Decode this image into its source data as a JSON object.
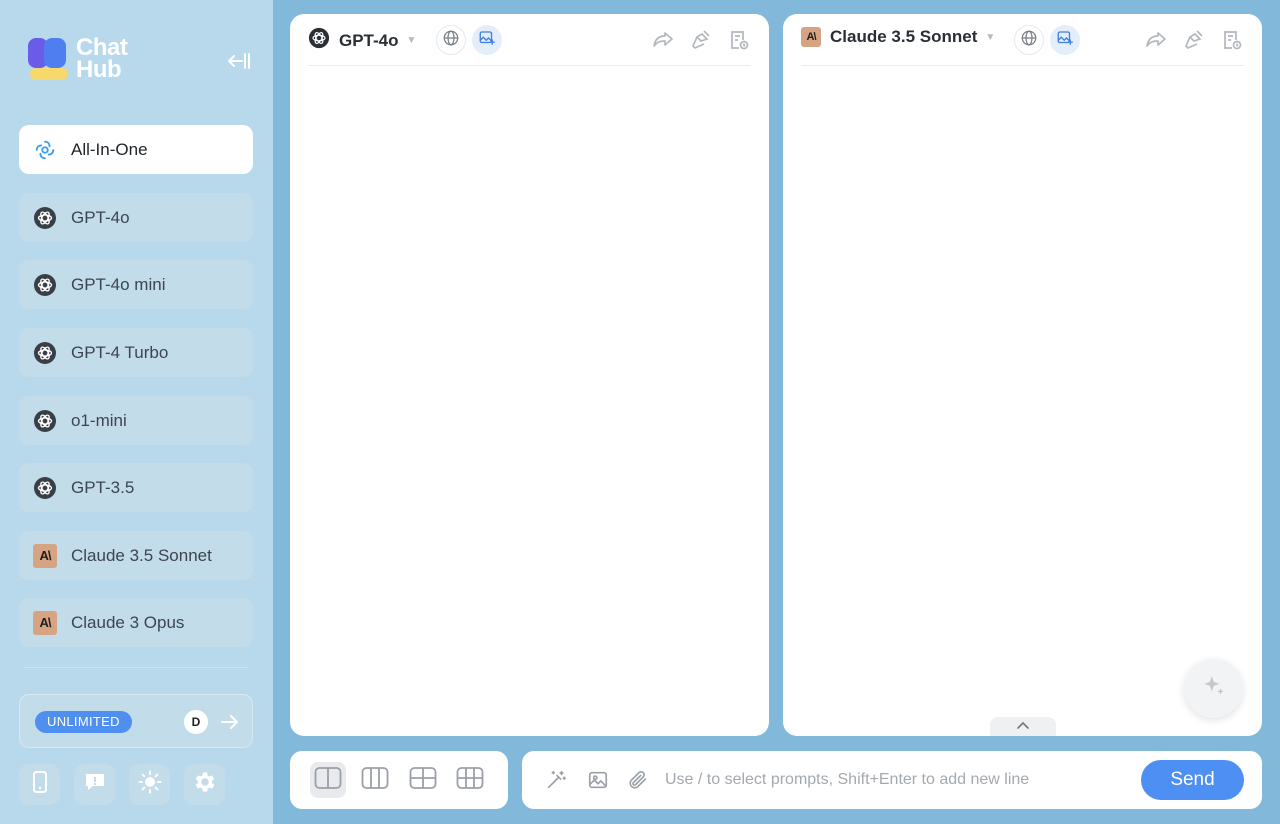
{
  "sidebar": {
    "logo_text_1": "Chat",
    "logo_text_2": "Hub",
    "items": [
      {
        "label": "All-In-One",
        "icon": "all-in-one-icon"
      },
      {
        "label": "GPT-4o",
        "icon": "openai-icon"
      },
      {
        "label": "GPT-4o mini",
        "icon": "openai-icon"
      },
      {
        "label": "GPT-4 Turbo",
        "icon": "openai-icon"
      },
      {
        "label": "o1-mini",
        "icon": "openai-icon"
      },
      {
        "label": "GPT-3.5",
        "icon": "openai-icon"
      },
      {
        "label": "Claude 3.5 Sonnet",
        "icon": "anthropic-icon"
      },
      {
        "label": "Claude 3 Opus",
        "icon": "anthropic-icon"
      }
    ],
    "claude_logo_text": "A\\",
    "plan": {
      "badge": "UNLIMITED",
      "avatar": "D"
    }
  },
  "panels": [
    {
      "model": "GPT-4o",
      "icon": "openai-icon"
    },
    {
      "model": "Claude 3.5 Sonnet",
      "icon": "anthropic-icon"
    }
  ],
  "composer": {
    "placeholder": "Use / to select prompts, Shift+Enter to add new line",
    "send_label": "Send"
  },
  "colors": {
    "accent": "#4d8ff2",
    "sidebar_bg": "#b8d8ec",
    "main_bg": "#82b8da"
  }
}
